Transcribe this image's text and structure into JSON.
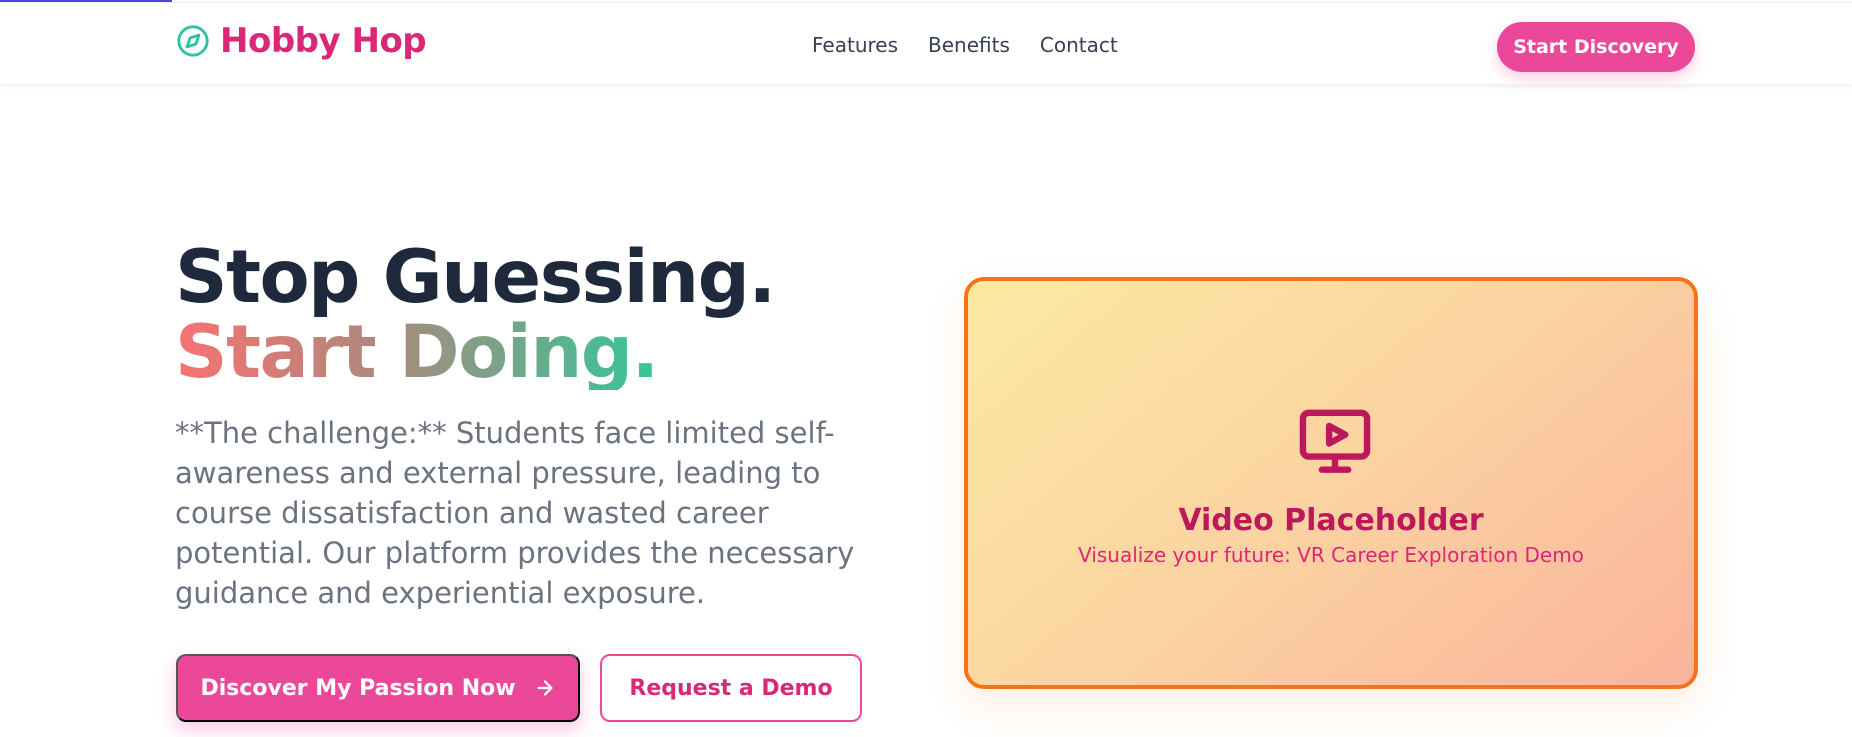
{
  "brand": {
    "name": "Hobby Hop",
    "icon": "compass-icon",
    "color": "#db2777"
  },
  "nav": {
    "items": [
      {
        "label": "Features"
      },
      {
        "label": "Benefits"
      },
      {
        "label": "Contact"
      }
    ]
  },
  "header": {
    "cta_label": "Start Discovery"
  },
  "hero": {
    "title_line1": "Stop Guessing.",
    "title_line2": "Start Doing.",
    "description": "**The challenge:** Students face limited self-awareness and external pressure, leading to course dissatisfaction and wasted career potential. Our platform provides the necessary guidance and experiential exposure.",
    "primary_button": "Discover My Passion Now",
    "primary_button_icon": "arrow-right-icon",
    "secondary_button": "Request a Demo"
  },
  "video": {
    "icon": "monitor-play-icon",
    "title": "Video Placeholder",
    "subtitle": "Visualize your future: VR Career Exploration Demo"
  },
  "colors": {
    "accent": "#ec4899",
    "card_border": "#f97316",
    "heading": "#1e293b",
    "body_text": "#6b7280"
  }
}
